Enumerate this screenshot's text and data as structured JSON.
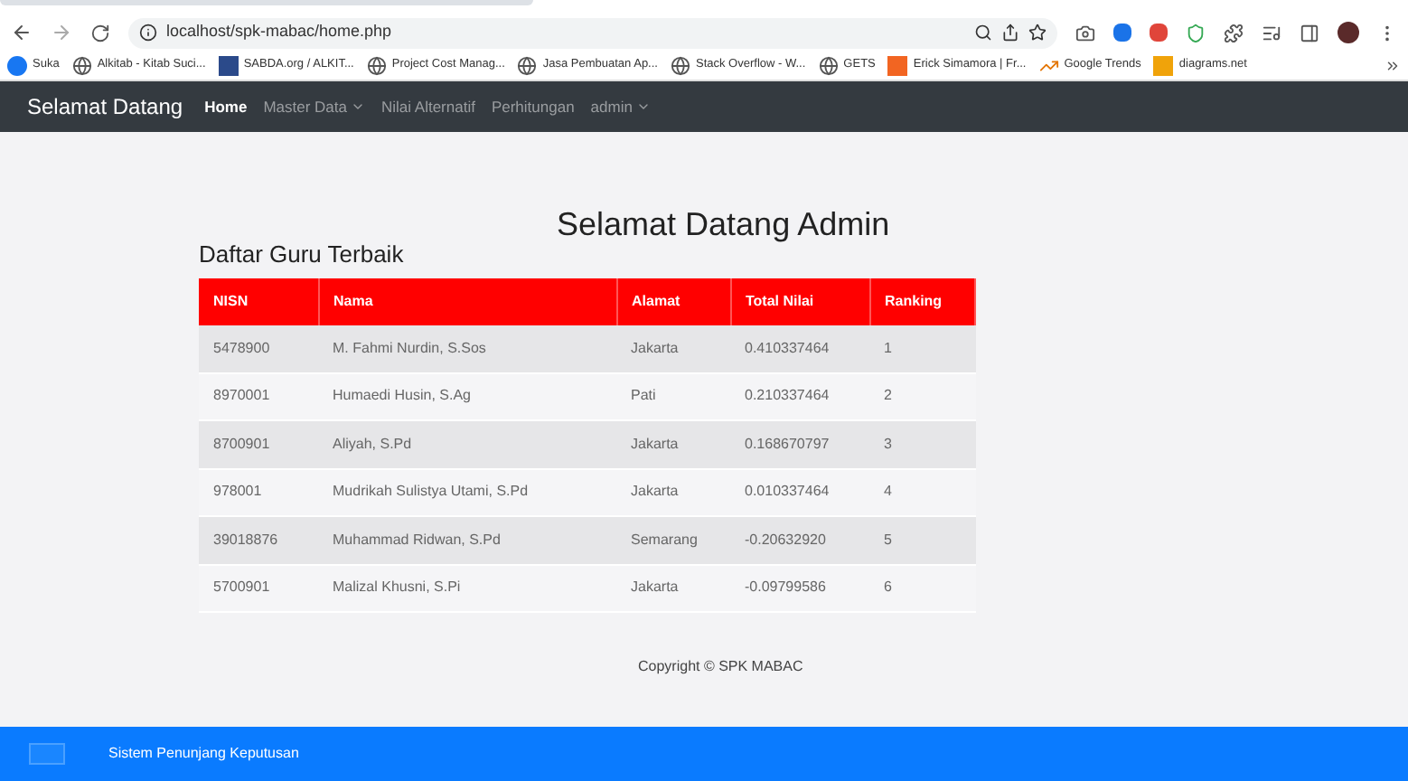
{
  "browser": {
    "url": "localhost/spk-mabac/home.php",
    "bookmarks": [
      {
        "label": "Suka",
        "kind": "facebook"
      },
      {
        "label": "Alkitab - Kitab Suci...",
        "kind": "globe"
      },
      {
        "label": "SABDA.org / ALKIT...",
        "kind": "square"
      },
      {
        "label": "Project Cost Manag...",
        "kind": "globe"
      },
      {
        "label": "Jasa Pembuatan Ap...",
        "kind": "globe"
      },
      {
        "label": "Stack Overflow - W...",
        "kind": "globe"
      },
      {
        "label": "GETS",
        "kind": "globe"
      },
      {
        "label": "Erick Simamora | Fr...",
        "kind": "orange"
      },
      {
        "label": "Google Trends",
        "kind": "trend"
      },
      {
        "label": "diagrams.net",
        "kind": "yellow"
      }
    ]
  },
  "navbar": {
    "brand": "Selamat Datang",
    "items": [
      {
        "label": "Home",
        "selected": true,
        "dropdown": false
      },
      {
        "label": "Master Data",
        "selected": false,
        "dropdown": true
      },
      {
        "label": "Nilai Alternatif",
        "selected": false,
        "dropdown": false
      },
      {
        "label": "Perhitungan",
        "selected": false,
        "dropdown": false
      },
      {
        "label": "admin",
        "selected": false,
        "dropdown": true
      }
    ]
  },
  "heading": "Selamat Datang Admin",
  "table": {
    "title": "Daftar Guru Terbaik",
    "columns": [
      "NISN",
      "Nama",
      "Alamat",
      "Total Nilai",
      "Ranking"
    ],
    "rows": [
      [
        "5478900",
        "M. Fahmi Nurdin, S.Sos",
        "Jakarta",
        "0.410337464",
        "1"
      ],
      [
        "8970001",
        "Humaedi Husin, S.Ag",
        "Pati",
        "0.210337464",
        "2"
      ],
      [
        "8700901",
        "Aliyah, S.Pd",
        "Jakarta",
        "0.168670797",
        "3"
      ],
      [
        "978001",
        "Mudrikah Sulistya Utami, S.Pd",
        "Jakarta",
        "0.010337464",
        "4"
      ],
      [
        "39018876",
        "Muhammad Ridwan, S.Pd",
        "Semarang",
        "-0.20632920",
        "5"
      ],
      [
        "5700901",
        "Malizal Khusni, S.Pi",
        "Jakarta",
        "-0.09799586",
        "6"
      ]
    ]
  },
  "copyright": "Copyright © SPK MABAC",
  "footer": {
    "text": "Sistem Penunjang Keputusan"
  }
}
